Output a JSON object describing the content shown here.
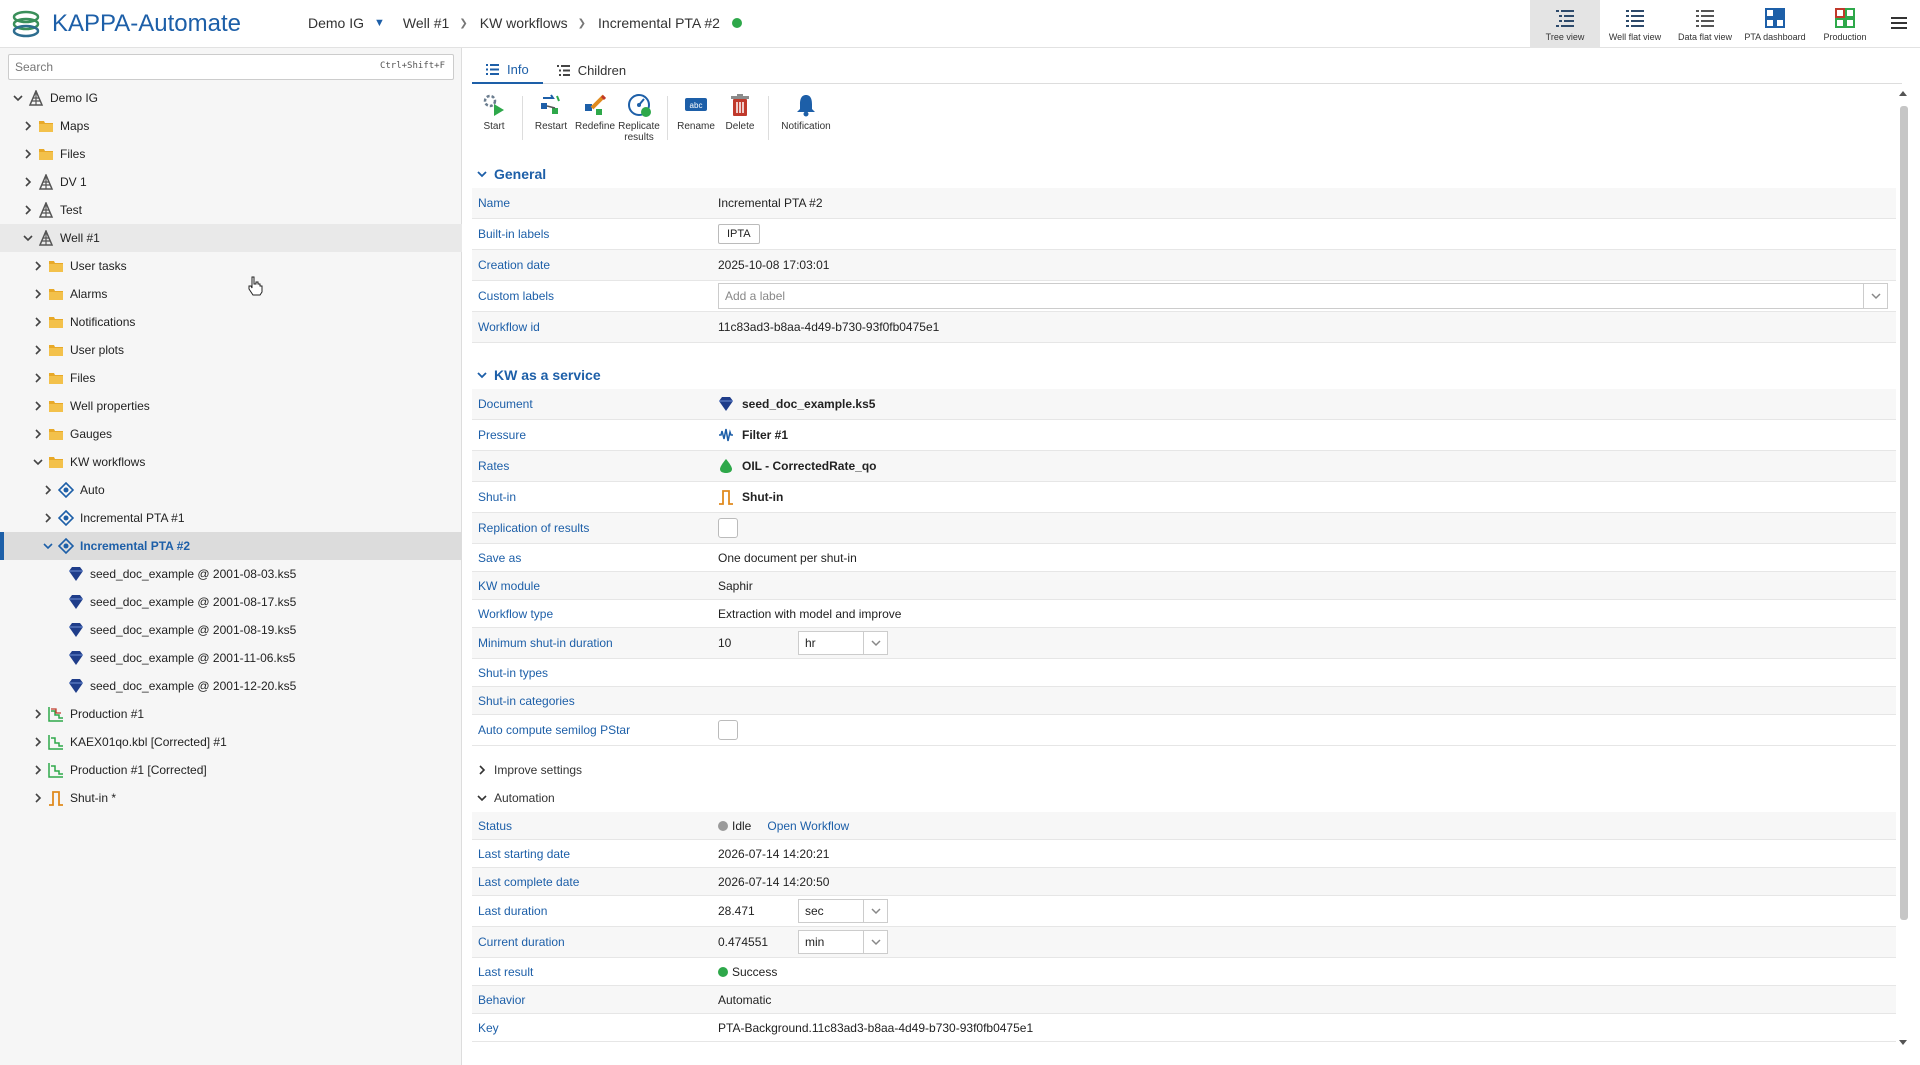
{
  "app": {
    "title": "KAPPA-Automate"
  },
  "breadcrumb": [
    "Demo IG",
    "Well #1",
    "KW workflows",
    "Incremental PTA #2"
  ],
  "views": [
    {
      "label": "Tree view",
      "icon": "tree-view-icon",
      "active": true
    },
    {
      "label": "Well flat view",
      "icon": "well-flat-view-icon",
      "active": false
    },
    {
      "label": "Data flat view",
      "icon": "data-flat-view-icon",
      "active": false
    },
    {
      "label": "PTA dashboard",
      "icon": "pta-dashboard-icon",
      "active": false
    },
    {
      "label": "Production",
      "icon": "production-icon",
      "active": false
    }
  ],
  "search": {
    "placeholder": "Search",
    "shortcut": "Ctrl+Shift+F"
  },
  "tree": [
    {
      "label": "Demo IG",
      "level": 0,
      "expanded": true,
      "icon": "field-icon"
    },
    {
      "label": "Maps",
      "level": 1,
      "expanded": false,
      "icon": "maps-folder-icon"
    },
    {
      "label": "Files",
      "level": 1,
      "expanded": false,
      "icon": "files-folder-icon"
    },
    {
      "label": "DV 1",
      "level": 1,
      "expanded": false,
      "icon": "field-icon"
    },
    {
      "label": "Test",
      "level": 1,
      "expanded": false,
      "icon": "field-icon"
    },
    {
      "label": "Well #1",
      "level": 1,
      "expanded": true,
      "icon": "field-icon"
    },
    {
      "label": "User tasks",
      "level": 2,
      "expanded": false,
      "icon": "user-tasks-folder-icon"
    },
    {
      "label": "Alarms",
      "level": 2,
      "expanded": false,
      "icon": "alarms-folder-icon"
    },
    {
      "label": "Notifications",
      "level": 2,
      "expanded": false,
      "icon": "notifications-folder-icon"
    },
    {
      "label": "User plots",
      "level": 2,
      "expanded": false,
      "icon": "user-plots-folder-icon"
    },
    {
      "label": "Files",
      "level": 2,
      "expanded": false,
      "icon": "files-folder-icon"
    },
    {
      "label": "Well properties",
      "level": 2,
      "expanded": false,
      "icon": "well-properties-folder-icon"
    },
    {
      "label": "Gauges",
      "level": 2,
      "expanded": false,
      "icon": "gauges-folder-icon"
    },
    {
      "label": "KW workflows",
      "level": 2,
      "expanded": true,
      "icon": "kw-workflows-folder-icon"
    },
    {
      "label": "Auto",
      "level": 3,
      "expanded": false,
      "icon": "workflow-icon"
    },
    {
      "label": "Incremental PTA #1",
      "level": 3,
      "expanded": false,
      "icon": "workflow-icon"
    },
    {
      "label": "Incremental PTA #2",
      "level": 3,
      "expanded": true,
      "icon": "workflow-icon",
      "selected": true
    },
    {
      "label": "seed_doc_example @ 2001-08-03.ks5",
      "level": 4,
      "leaf": true,
      "icon": "ks5-document-icon"
    },
    {
      "label": "seed_doc_example @ 2001-08-17.ks5",
      "level": 4,
      "leaf": true,
      "icon": "ks5-document-icon"
    },
    {
      "label": "seed_doc_example @ 2001-08-19.ks5",
      "level": 4,
      "leaf": true,
      "icon": "ks5-document-icon"
    },
    {
      "label": "seed_doc_example @ 2001-11-06.ks5",
      "level": 4,
      "leaf": true,
      "icon": "ks5-document-icon"
    },
    {
      "label": "seed_doc_example @ 2001-12-20.ks5",
      "level": 4,
      "leaf": true,
      "icon": "ks5-document-icon"
    },
    {
      "label": "Production #1",
      "level": 2,
      "expanded": false,
      "icon": "production-data-icon"
    },
    {
      "label": "KAEX01qo.kbl [Corrected] #1",
      "level": 2,
      "expanded": false,
      "icon": "rate-data-icon"
    },
    {
      "label": "Production #1 [Corrected]",
      "level": 2,
      "expanded": false,
      "icon": "rate-data-icon"
    },
    {
      "label": "Shut-in *",
      "level": 2,
      "expanded": false,
      "icon": "shut-in-icon"
    }
  ],
  "tabs": [
    {
      "label": "Info",
      "active": true,
      "icon": "list-icon"
    },
    {
      "label": "Children",
      "active": false,
      "icon": "children-list-icon"
    }
  ],
  "toolbar": [
    {
      "label": "Start",
      "icon": "start-icon"
    },
    {
      "label": "Restart",
      "icon": "restart-icon"
    },
    {
      "label": "Redefine",
      "icon": "redefine-icon"
    },
    {
      "label": "Replicate results",
      "icon": "replicate-results-icon"
    },
    {
      "label": "Rename",
      "icon": "rename-icon"
    },
    {
      "label": "Delete",
      "icon": "delete-icon"
    },
    {
      "label": "Notification",
      "icon": "bell-icon"
    }
  ],
  "general": {
    "title": "General",
    "name_label": "Name",
    "name": "Incremental PTA #2",
    "builtin_label": "Built-in labels",
    "builtin": "IPTA",
    "created_label": "Creation date",
    "created": "2025-10-08 17:03:01",
    "custom_label": "Custom labels",
    "custom_placeholder": "Add a label",
    "wfid_label": "Workflow id",
    "wfid": "11c83ad3-b8aa-4d49-b730-93f0fb0475e1"
  },
  "service": {
    "title": "KW as a service",
    "document_label": "Document",
    "document": "seed_doc_example.ks5",
    "pressure_label": "Pressure",
    "pressure": "Filter #1",
    "rates_label": "Rates",
    "rates": "OIL - CorrectedRate_qo",
    "shutin_label": "Shut-in",
    "shutin": "Shut-in",
    "replication_label": "Replication of results",
    "saveas_label": "Save as",
    "saveas": "One document per shut-in",
    "module_label": "KW module",
    "module": "Saphir",
    "wftype_label": "Workflow type",
    "wftype": "Extraction with model and improve",
    "minshut_label": "Minimum shut-in duration",
    "minshut": "10",
    "minshut_unit": "hr",
    "shuttypes_label": "Shut-in types",
    "shutcats_label": "Shut-in categories",
    "semilog_label": "Auto compute semilog PStar"
  },
  "improve": {
    "title": "Improve settings"
  },
  "automation": {
    "title": "Automation",
    "status_label": "Status",
    "status": "Idle",
    "open_workflow": "Open Workflow",
    "last_start_label": "Last starting date",
    "last_start": "2026-07-14 14:20:21",
    "last_complete_label": "Last complete date",
    "last_complete": "2026-07-14 14:20:50",
    "last_duration_label": "Last duration",
    "last_duration": "28.471",
    "last_duration_unit": "sec",
    "current_duration_label": "Current duration",
    "current_duration": "0.474551",
    "current_duration_unit": "min",
    "last_result_label": "Last result",
    "last_result": "Success",
    "behavior_label": "Behavior",
    "behavior": "Automatic",
    "key_label": "Key",
    "key": "PTA-Background.11c83ad3-b8aa-4d49-b730-93f0fb0475e1"
  },
  "colors": {
    "accent": "#1d5fa8",
    "success": "#2ea84a",
    "idle": "#9a9a9a"
  }
}
